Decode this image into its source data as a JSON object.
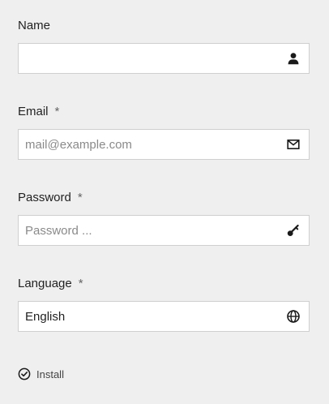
{
  "form": {
    "name": {
      "label": "Name",
      "value": "",
      "placeholder": "",
      "icon": "user-icon"
    },
    "email": {
      "label": "Email",
      "required_mark": "*",
      "value": "",
      "placeholder": "mail@example.com",
      "icon": "envelope-icon"
    },
    "password": {
      "label": "Password",
      "required_mark": "*",
      "value": "",
      "placeholder": "Password ...",
      "icon": "key-icon"
    },
    "language": {
      "label": "Language",
      "required_mark": "*",
      "value": "English",
      "placeholder": "",
      "icon": "globe-icon"
    }
  },
  "install": {
    "label": "Install",
    "icon": "check-circle-icon"
  }
}
